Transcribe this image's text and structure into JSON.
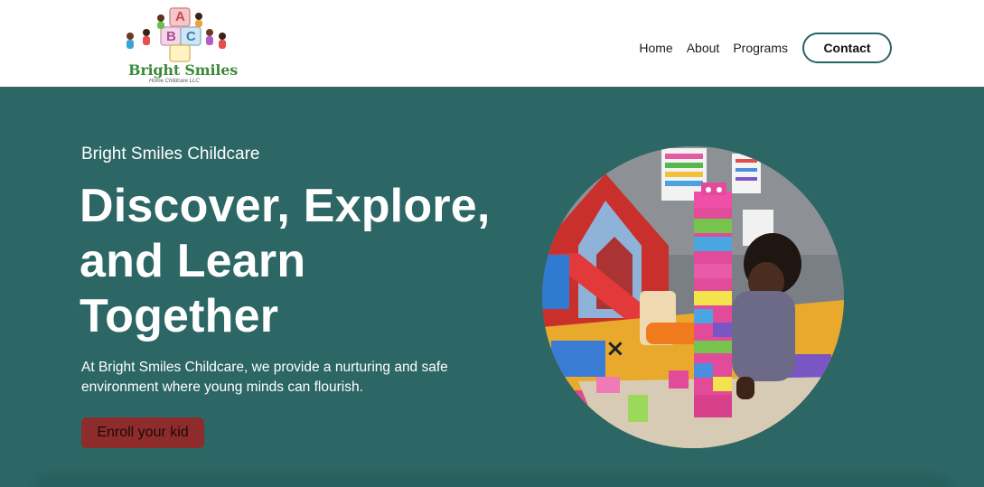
{
  "brand": {
    "name": "Bright Smiles",
    "tagline": "Home Childcare LLC",
    "block_letters": [
      "A",
      "B",
      "C"
    ]
  },
  "nav": {
    "items": [
      {
        "label": "Home"
      },
      {
        "label": "About"
      },
      {
        "label": "Programs"
      }
    ],
    "contact_label": "Contact"
  },
  "hero": {
    "eyebrow": "Bright Smiles Childcare",
    "headline": "Discover, Explore, and Learn Together",
    "description": "At Bright Smiles Childcare, we provide a nurturing and safe environment where young minds can flourish.",
    "cta_label": "Enroll your kid"
  },
  "colors": {
    "hero_bg": "#2c6665",
    "cta_bg": "#8e2b2b",
    "contact_border": "#2a6463",
    "brand_green": "#3c8a3a"
  }
}
